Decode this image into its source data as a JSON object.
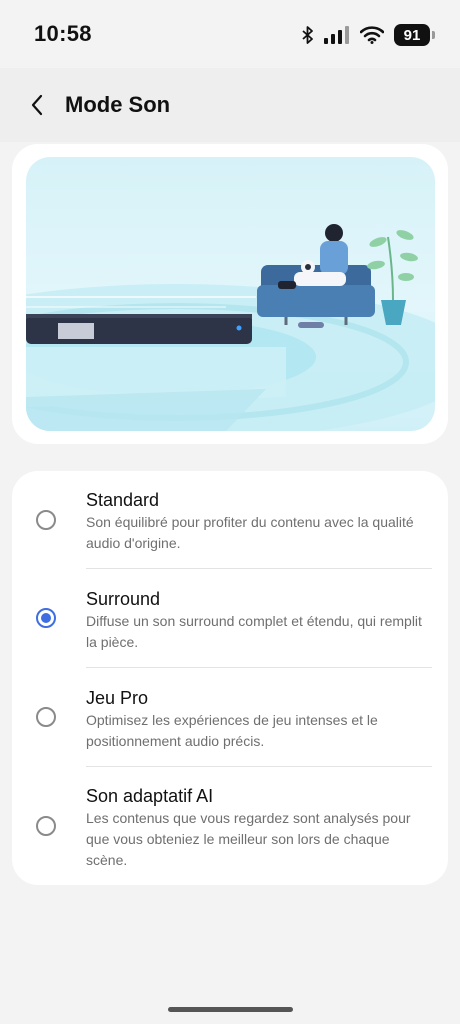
{
  "status_bar": {
    "time": "10:58",
    "battery": "91",
    "icons": [
      "bluetooth-icon",
      "signal-icon",
      "wifi-icon",
      "battery-icon"
    ]
  },
  "header": {
    "back_icon": "chevron-left-icon",
    "title": "Mode Son"
  },
  "hero": {
    "image": "soundbar-living-room-illustration"
  },
  "options": [
    {
      "title": "Standard",
      "description": "Son équilibré pour profiter du contenu avec la qualité audio d'origine.",
      "selected": false
    },
    {
      "title": "Surround",
      "description": "Diffuse un son surround complet et étendu, qui remplit la pièce.",
      "selected": true
    },
    {
      "title": "Jeu Pro",
      "description": "Optimisez les expériences de jeu intenses et le positionnement audio précis.",
      "selected": false
    },
    {
      "title": "Son adaptatif AI",
      "description": "Les contenus que vous regardez sont analysés pour que vous obteniez le meilleur son lors de chaque scène.",
      "selected": false
    }
  ],
  "colors": {
    "accent": "#3e6ee0",
    "background": "#f3f3f3",
    "card": "#ffffff"
  }
}
